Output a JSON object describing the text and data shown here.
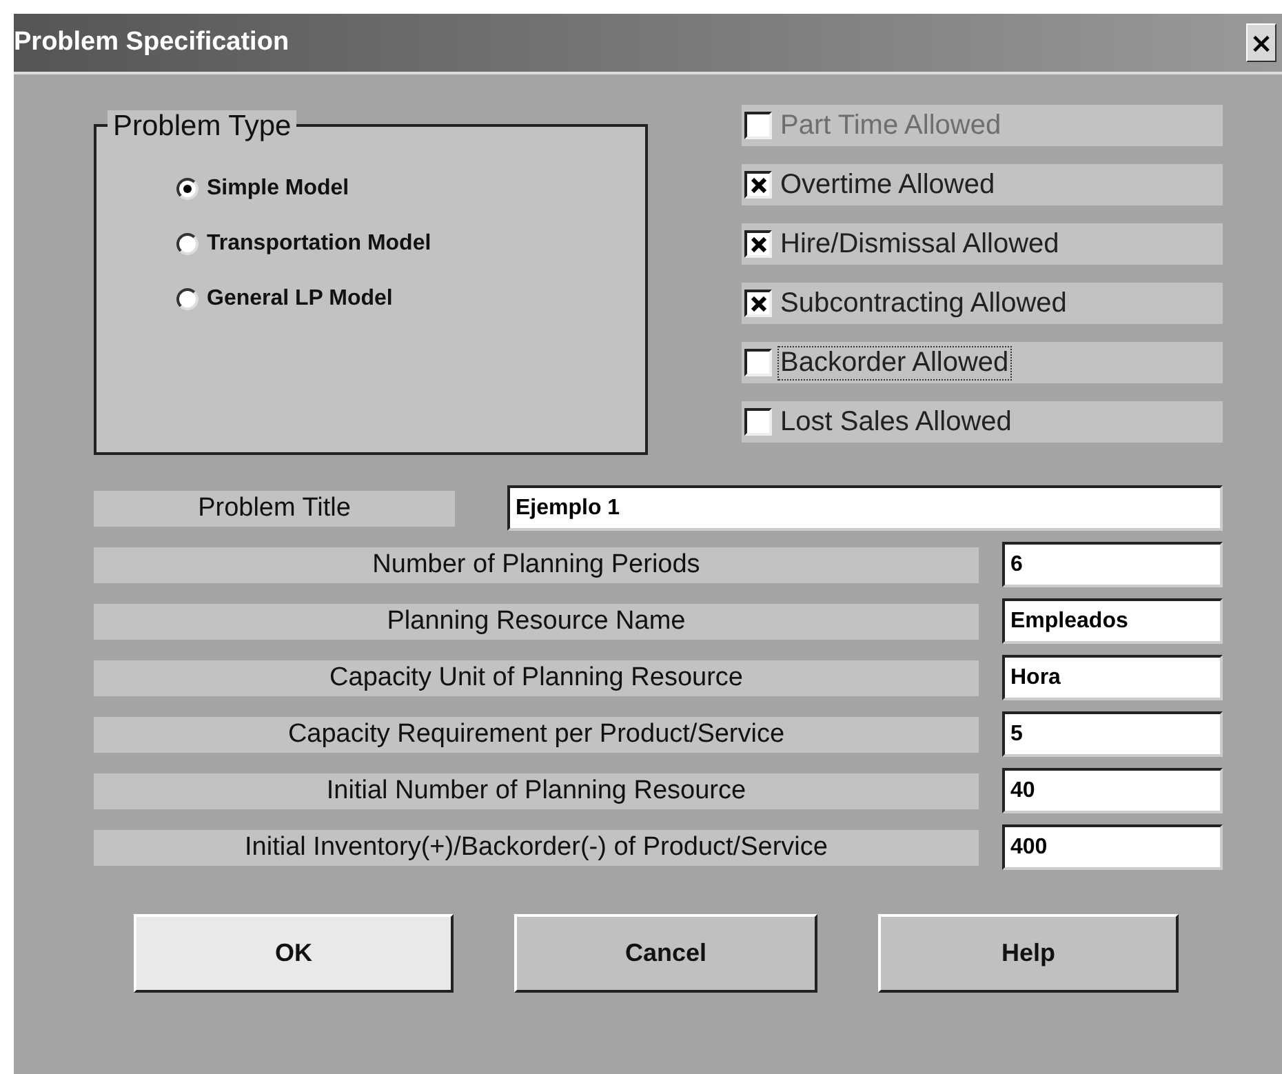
{
  "window": {
    "title": "Problem Specification",
    "close": "×"
  },
  "problem_type": {
    "title": "Problem Type",
    "options": [
      {
        "label": "Simple Model",
        "selected": true
      },
      {
        "label": "Transportation Model",
        "selected": false
      },
      {
        "label": "General LP Model",
        "selected": false
      }
    ]
  },
  "options": [
    {
      "label": "Part Time Allowed",
      "checked": false,
      "disabled": true,
      "focused": false
    },
    {
      "label": "Overtime Allowed",
      "checked": true,
      "disabled": false,
      "focused": false
    },
    {
      "label": "Hire/Dismissal Allowed",
      "checked": true,
      "disabled": false,
      "focused": false
    },
    {
      "label": "Subcontracting Allowed",
      "checked": true,
      "disabled": false,
      "focused": false
    },
    {
      "label": "Backorder Allowed",
      "checked": false,
      "disabled": false,
      "focused": true
    },
    {
      "label": "Lost Sales Allowed",
      "checked": false,
      "disabled": false,
      "focused": false
    }
  ],
  "problem_title": {
    "label": "Problem Title",
    "value": "Ejemplo 1"
  },
  "fields": [
    {
      "label": "Number of Planning Periods",
      "value": "6"
    },
    {
      "label": "Planning Resource Name",
      "value": "Empleados"
    },
    {
      "label": "Capacity Unit of Planning Resource",
      "value": "Hora"
    },
    {
      "label": "Capacity Requirement per Product/Service",
      "value": "5"
    },
    {
      "label": "Initial Number of Planning Resource",
      "value": "40"
    },
    {
      "label": "Initial Inventory(+)/Backorder(-) of Product/Service",
      "value": "400"
    }
  ],
  "buttons": [
    {
      "label": "OK",
      "default": true
    },
    {
      "label": "Cancel",
      "default": false
    },
    {
      "label": "Help",
      "default": false
    }
  ]
}
